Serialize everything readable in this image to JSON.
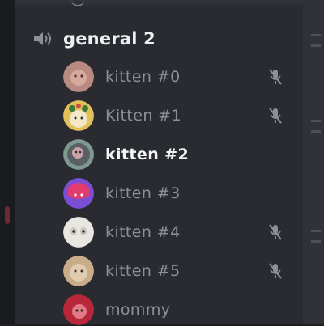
{
  "voice_channel": {
    "name": "general 2",
    "icon": "speaker-icon"
  },
  "members": [
    {
      "name": "kitten #0",
      "muted": true,
      "active": false,
      "avatar_color": "#b88a82"
    },
    {
      "name": "Kitten #1",
      "muted": true,
      "active": false,
      "avatar_color": "#e2c15a"
    },
    {
      "name": "kitten #2",
      "muted": false,
      "active": true,
      "avatar_color": "#7e9a8f"
    },
    {
      "name": "kitten #3",
      "muted": false,
      "active": false,
      "avatar_color": "#7a4fd6"
    },
    {
      "name": "kitten #4",
      "muted": true,
      "active": false,
      "avatar_color": "#e9e6e1"
    },
    {
      "name": "kitten #5",
      "muted": true,
      "active": false,
      "avatar_color": "#c9ad8b"
    },
    {
      "name": "mommy",
      "muted": false,
      "active": false,
      "avatar_color": "#b8283a"
    }
  ],
  "icons": {
    "mute": "mic-muted-icon"
  },
  "colors": {
    "panel_bg": "#2a2b31",
    "active_text": "#f4f5f7",
    "muted_text": "#8e9099"
  }
}
